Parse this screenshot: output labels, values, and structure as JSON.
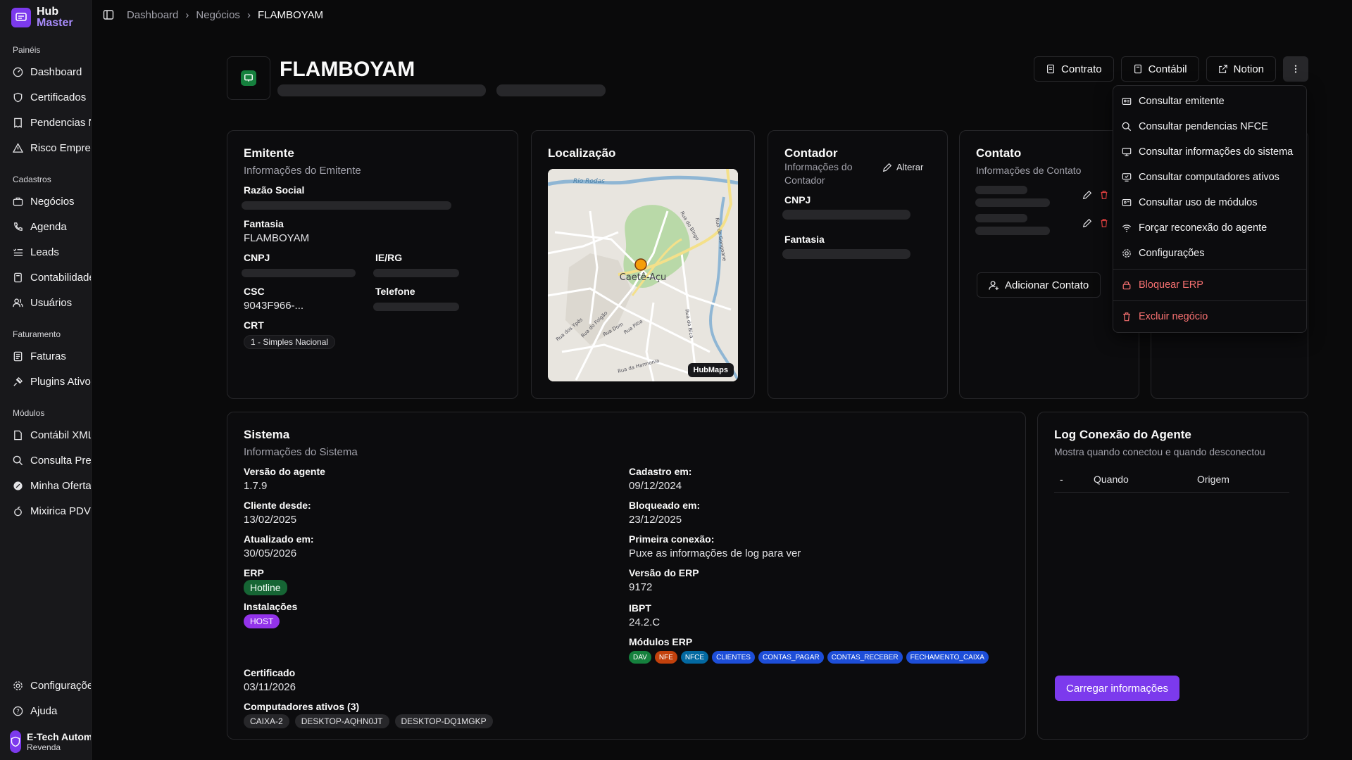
{
  "brand": {
    "line1": "Hub",
    "line2": "Master"
  },
  "sidebar": {
    "groups": [
      {
        "title": "Painéis",
        "items": [
          "Dashboard",
          "Certificados",
          "Pendencias NFCE",
          "Risco Empresa"
        ]
      },
      {
        "title": "Cadastros",
        "items": [
          "Negócios",
          "Agenda",
          "Leads",
          "Contabilidade",
          "Usuários"
        ]
      },
      {
        "title": "Faturamento",
        "items": [
          "Faturas",
          "Plugins Ativos"
        ]
      },
      {
        "title": "Módulos",
        "items": [
          "Contábil XML",
          "Consulta Preços",
          "Minha Oferta",
          "Mixirica PDV"
        ]
      }
    ],
    "bottom": [
      "Configurações",
      "Ajuda"
    ],
    "user": {
      "name": "E-Tech Automação",
      "role": "Revenda"
    }
  },
  "breadcrumb": [
    "Dashboard",
    "Negócios",
    "FLAMBOYAM"
  ],
  "header": {
    "title": "FLAMBOYAM",
    "actions": [
      "Contrato",
      "Contábil",
      "Notion"
    ]
  },
  "menu": {
    "items": [
      "Consultar emitente",
      "Consultar pendencias NFCE",
      "Consultar informações do sistema",
      "Consultar computadores ativos",
      "Consultar uso de módulos",
      "Forçar reconexão do agente",
      "Configurações"
    ],
    "lock": "Bloquear ERP",
    "delete": "Excluir negócio"
  },
  "emitente": {
    "title": "Emitente",
    "subtitle": "Informações do Emitente",
    "razao_label": "Razão Social",
    "fantasia_label": "Fantasia",
    "fantasia_value": "FLAMBOYAM",
    "cnpj_label": "CNPJ",
    "ie_label": "IE/RG",
    "csc_label": "CSC",
    "csc_value": "9043F966-...",
    "telefone_label": "Telefone",
    "crt_label": "CRT",
    "crt_value": "1 - Simples Nacional"
  },
  "localizacao": {
    "title": "Localização",
    "city": "Caetê-Açu",
    "rio": "Rio Rodas",
    "streets": [
      "Rua do Bingo",
      "Rua do Gongoane",
      "Rua dos Ypês",
      "Rua do Folgão",
      "Rua Dom",
      "Rua Pitia",
      "Rua do Bica",
      "Rua da Harmonia"
    ],
    "badge": "HubMaps"
  },
  "contador": {
    "title": "Contador",
    "subtitle": "Informações do Contador",
    "edit": "Alterar",
    "cnpj_label": "CNPJ",
    "fantasia_label": "Fantasia"
  },
  "contato": {
    "title": "Contato",
    "subtitle": "Informações de Contato",
    "add": "Adicionar Contato"
  },
  "sistema": {
    "title": "Sistema",
    "subtitle": "Informações do Sistema",
    "left": [
      {
        "label": "Versão do agente",
        "value": "1.7.9"
      },
      {
        "label": "Cliente desde:",
        "value": "13/02/2025"
      },
      {
        "label": "Atualizado em:",
        "value": "30/05/2026"
      }
    ],
    "right": [
      {
        "label": "Cadastro em:",
        "value": "09/12/2024"
      },
      {
        "label": "Bloqueado em:",
        "value": "23/12/2025"
      },
      {
        "label": "Primeira conexão:",
        "value": "Puxe as informações de log para ver"
      },
      {
        "label": "Versão do ERP",
        "value": "9172"
      },
      {
        "label": "IBPT",
        "value": "24.2.C"
      }
    ],
    "erp_label": "ERP",
    "erp_value": "Hotline",
    "inst_label": "Instalações",
    "inst_value": "HOST",
    "modulos_label": "Módulos ERP",
    "modulos": [
      {
        "name": "DAV",
        "color": "#15803d"
      },
      {
        "name": "NFE",
        "color": "#c2410c"
      },
      {
        "name": "NFCE",
        "color": "#0369a1"
      },
      {
        "name": "CLIENTES",
        "color": "#1d4ed8"
      },
      {
        "name": "CONTAS_PAGAR",
        "color": "#1d4ed8"
      },
      {
        "name": "CONTAS_RECEBER",
        "color": "#1d4ed8"
      },
      {
        "name": "FECHAMENTO_CAIXA",
        "color": "#1d4ed8"
      }
    ],
    "cert_label": "Certificado",
    "cert_value": "03/11/2026",
    "computers_label": "Computadores ativos (3)",
    "computers": [
      "CAIXA-2",
      "DESKTOP-AQHN0JT",
      "DESKTOP-DQ1MGKP"
    ]
  },
  "log": {
    "title": "Log Conexão do Agente",
    "subtitle": "Mostra quando conectou e quando desconectou",
    "columns": [
      "-",
      "Quando",
      "Origem"
    ],
    "button": "Carregar informações"
  }
}
